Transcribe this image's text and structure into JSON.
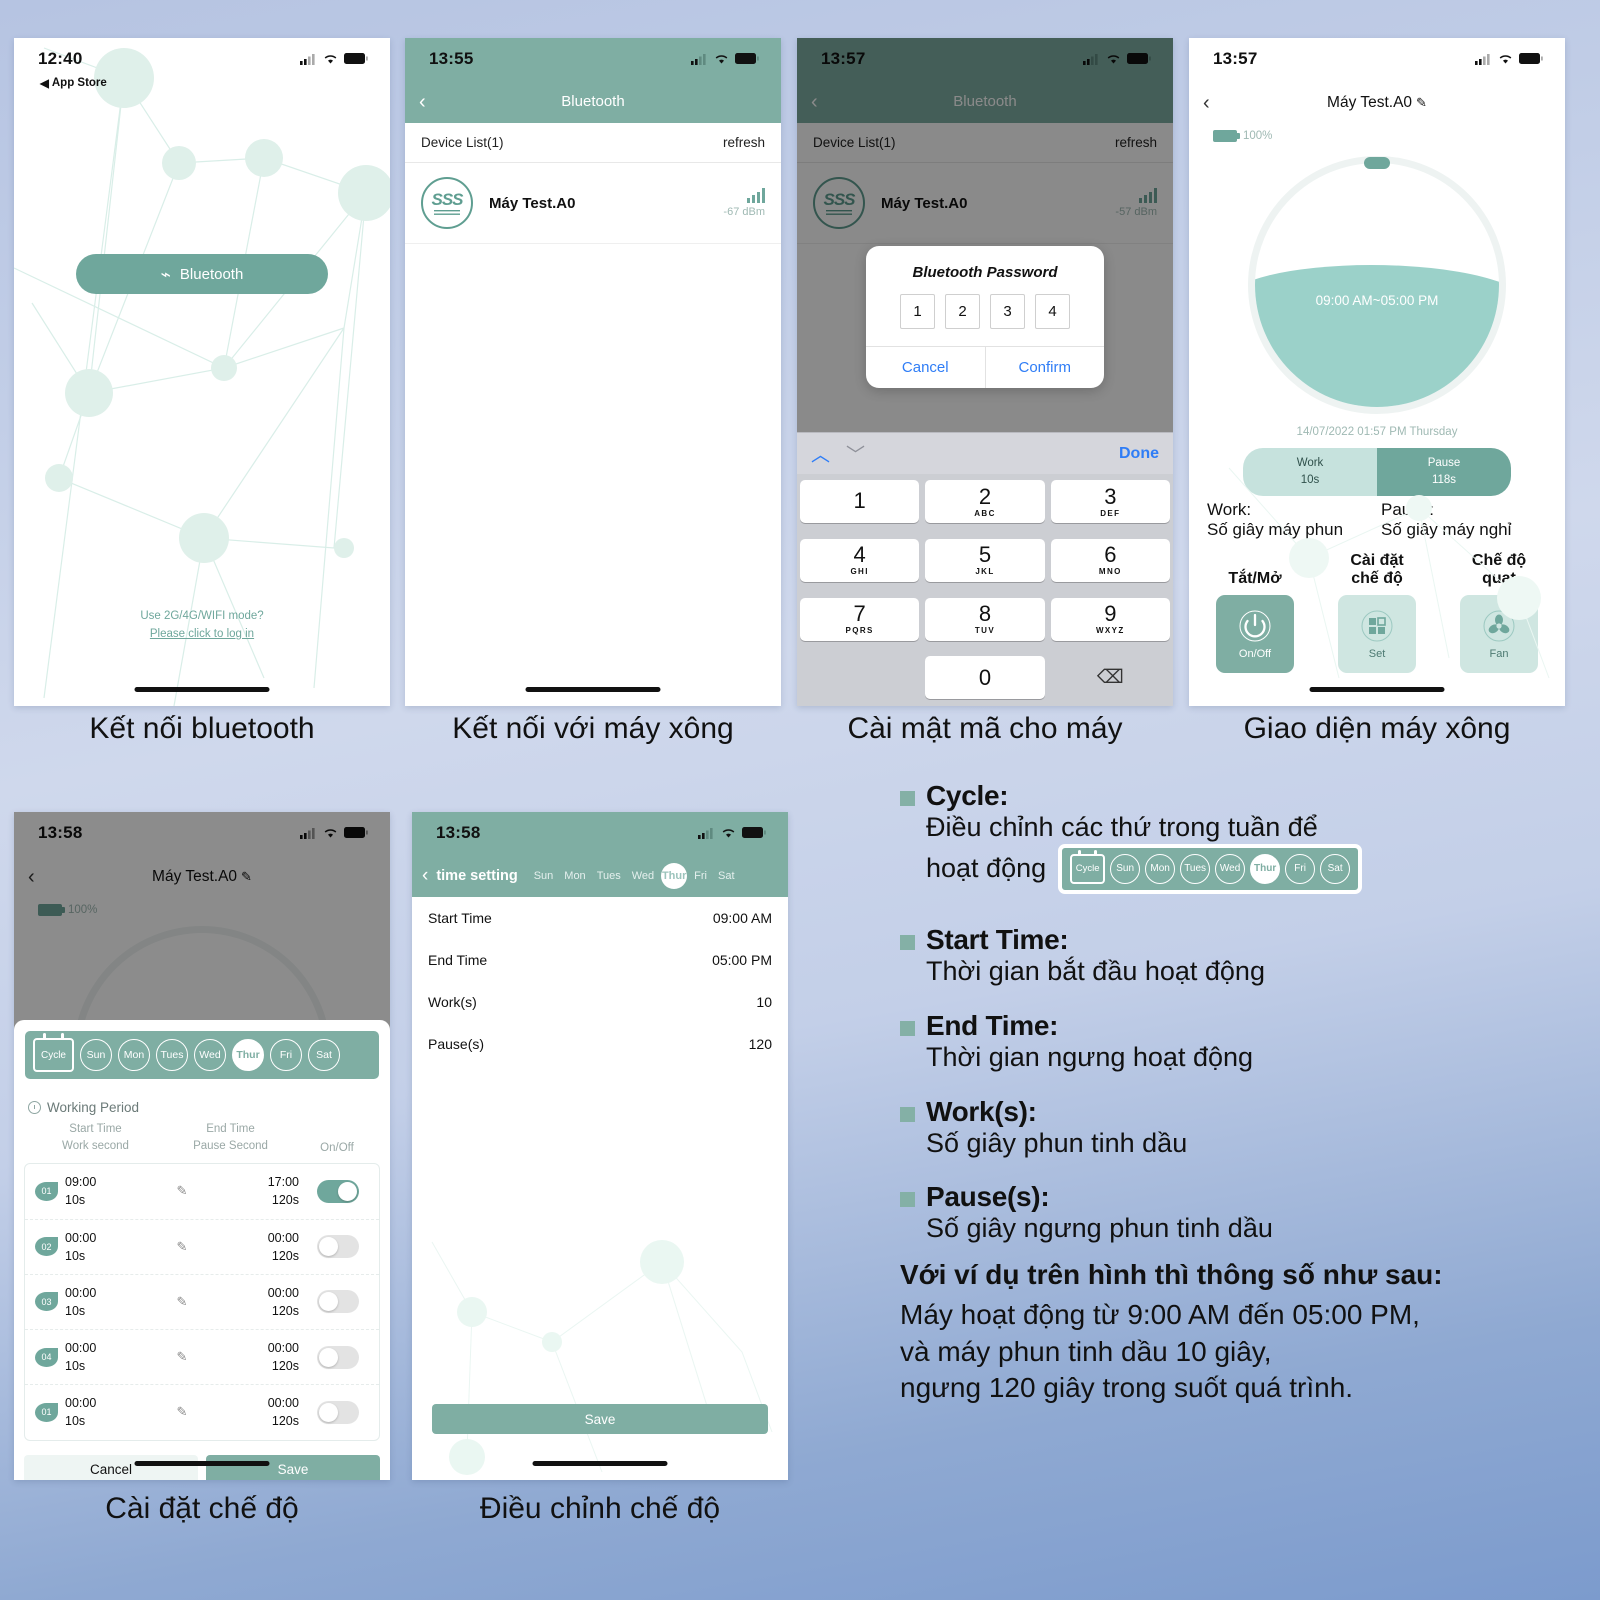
{
  "phone1": {
    "status": {
      "time": "12:40"
    },
    "back_app": "App Store",
    "bluetooth_button": "Bluetooth",
    "hint_line1": "Use 2G/4G/WIFI mode?",
    "hint_line2": "Please click to log in",
    "caption": "Kết nối bluetooth"
  },
  "phone2": {
    "status": {
      "time": "13:55"
    },
    "nav_title": "Bluetooth",
    "list_header": "Device List(1)",
    "refresh": "refresh",
    "device": {
      "avatar_text": "SSS",
      "name": "Máy Test.A0",
      "rssi": "-67 dBm"
    },
    "caption": "Kết nối với máy xông"
  },
  "phone3": {
    "status": {
      "time": "13:57"
    },
    "nav_title": "Bluetooth",
    "list_header": "Device List(1)",
    "refresh": "refresh",
    "device": {
      "avatar_text": "SSS",
      "name": "Máy Test.A0",
      "rssi": "-57 dBm"
    },
    "dialog": {
      "title": "Bluetooth Password",
      "digits": [
        "1",
        "2",
        "3",
        "4"
      ],
      "cancel": "Cancel",
      "confirm": "Confirm"
    },
    "keyboard": {
      "done": "Done",
      "keys": [
        {
          "num": "1",
          "letters": ""
        },
        {
          "num": "2",
          "letters": "ABC"
        },
        {
          "num": "3",
          "letters": "DEF"
        },
        {
          "num": "4",
          "letters": "GHI"
        },
        {
          "num": "5",
          "letters": "JKL"
        },
        {
          "num": "6",
          "letters": "MNO"
        },
        {
          "num": "7",
          "letters": "PQRS"
        },
        {
          "num": "8",
          "letters": "TUV"
        },
        {
          "num": "9",
          "letters": "WXYZ"
        },
        {
          "num": "0",
          "letters": ""
        }
      ]
    },
    "caption": "Cài mật mã cho máy"
  },
  "phone4": {
    "status": {
      "time": "13:57"
    },
    "title": "Máy Test.A0",
    "battery": "100%",
    "dial_label": "09:00 AM~05:00 PM",
    "datetime": "14/07/2022 01:57 PM Thursday",
    "work_pill": {
      "label": "Work",
      "value": "10s"
    },
    "pause_pill": {
      "label": "Pause",
      "value": "118s"
    },
    "work_desc": {
      "head": "Work:",
      "body": "Số giây máy phun"
    },
    "pause_desc": {
      "head": "Pause:",
      "body": "Số giây máy nghỉ"
    },
    "controls": [
      {
        "caption": "Tắt/Mở",
        "label": "On/Off",
        "icon": "power-icon",
        "active": true
      },
      {
        "caption": "Cài đặt\nchế độ",
        "label": "Set",
        "icon": "grid-icon",
        "active": false
      },
      {
        "caption": "Chế độ\nquạt",
        "label": "Fan",
        "icon": "fan-icon",
        "active": false
      }
    ],
    "caption": "Giao diện máy xông"
  },
  "phone5": {
    "status": {
      "time": "13:58"
    },
    "title": "Máy Test.A0",
    "battery": "100%",
    "cycle_label": "Cycle",
    "days": [
      "Sun",
      "Mon",
      "Tues",
      "Wed",
      "Thur",
      "Fri",
      "Sat"
    ],
    "active_day": "Thur",
    "working_period": "Working Period",
    "columns": {
      "c1_top": "Start Time",
      "c1_bot": "Work second",
      "c2_top": "End Time",
      "c2_bot": "Pause Second",
      "c3": "On/Off"
    },
    "rows": [
      {
        "no": "01",
        "start": "09:00",
        "work": "10s",
        "end": "17:00",
        "pause": "120s",
        "on": true
      },
      {
        "no": "02",
        "start": "00:00",
        "work": "10s",
        "end": "00:00",
        "pause": "120s",
        "on": false
      },
      {
        "no": "03",
        "start": "00:00",
        "work": "10s",
        "end": "00:00",
        "pause": "120s",
        "on": false
      },
      {
        "no": "04",
        "start": "00:00",
        "work": "10s",
        "end": "00:00",
        "pause": "120s",
        "on": false
      },
      {
        "no": "01",
        "start": "00:00",
        "work": "10s",
        "end": "00:00",
        "pause": "120s",
        "on": false
      }
    ],
    "cancel": "Cancel",
    "save": "Save",
    "caption": "Cài đặt chế độ"
  },
  "phone6": {
    "status": {
      "time": "13:58"
    },
    "nav_title": "time setting",
    "days": [
      "Sun",
      "Mon",
      "Tues",
      "Wed",
      "Thur",
      "Fri",
      "Sat"
    ],
    "active_day": "Thur",
    "rows": [
      {
        "label": "Start Time",
        "value": "09:00 AM"
      },
      {
        "label": "End Time",
        "value": "05:00 PM"
      },
      {
        "label": "Work(s)",
        "value": "10"
      },
      {
        "label": "Pause(s)",
        "value": "120"
      }
    ],
    "save": "Save",
    "caption": "Điều chỉnh chế độ"
  },
  "legend": {
    "items": [
      {
        "term": "Cycle:",
        "desc_line1": "Điều chỉnh các thứ trong tuần để",
        "desc_line2": "hoạt động"
      },
      {
        "term": "Start Time:",
        "desc_line1": "Thời gian bắt đầu hoạt động",
        "desc_line2": ""
      },
      {
        "term": "End Time:",
        "desc_line1": "Thời gian ngưng hoạt động",
        "desc_line2": ""
      },
      {
        "term": "Work(s):",
        "desc_line1": "Số giây phun tinh dầu",
        "desc_line2": ""
      },
      {
        "term": "Pause(s):",
        "desc_line1": "Số giây ngưng phun tinh dầu",
        "desc_line2": ""
      }
    ],
    "mini_cycle": {
      "label": "Cycle",
      "days": [
        "Sun",
        "Mon",
        "Tues",
        "Wed",
        "Thur",
        "Fri",
        "Sat"
      ],
      "active_day": "Thur"
    },
    "summary_title": "Với ví dụ trên hình thì thông số như sau:",
    "summary_line1": "Máy hoạt động từ 9:00 AM đến 05:00 PM,",
    "summary_line2": "và máy phun tinh dầu 10 giây,",
    "summary_line3": "ngưng 120 giây trong suốt quá trình."
  },
  "colors": {
    "accent": "#7faea3",
    "accent_light": "#cfe6e1",
    "dial": "#9bd1c9",
    "link": "#2f7df6"
  }
}
